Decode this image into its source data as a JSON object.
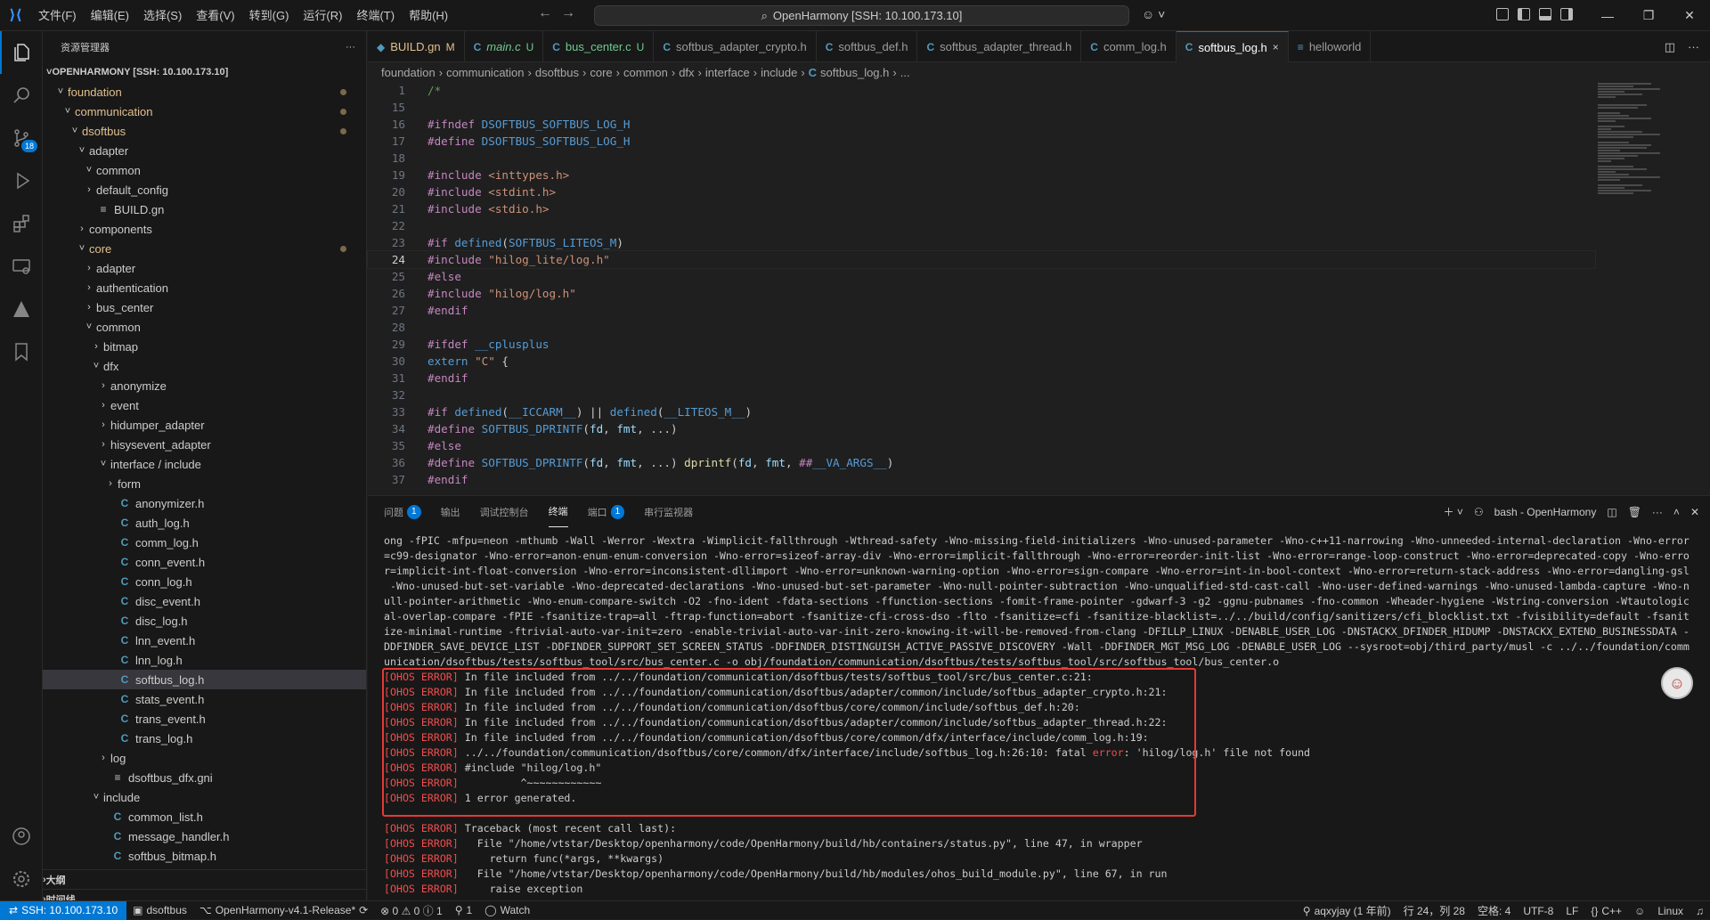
{
  "titlebar": {
    "menu": [
      "文件(F)",
      "编辑(E)",
      "选择(S)",
      "查看(V)",
      "转到(G)",
      "运行(R)",
      "终端(T)",
      "帮助(H)"
    ],
    "search": "OpenHarmony [SSH: 10.100.173.10]"
  },
  "activity": {
    "scm_badge": "18"
  },
  "sidebar": {
    "title": "资源管理器",
    "root": "OPENHARMONY [SSH: 10.100.173.10]",
    "tree": [
      {
        "label": "foundation",
        "depth": 1,
        "type": "folder-open",
        "mod": true
      },
      {
        "label": "communication",
        "depth": 2,
        "type": "folder-open",
        "mod": true
      },
      {
        "label": "dsoftbus",
        "depth": 3,
        "type": "folder-open",
        "mod": true
      },
      {
        "label": "adapter",
        "depth": 4,
        "type": "folder-open"
      },
      {
        "label": "common",
        "depth": 5,
        "type": "folder-open"
      },
      {
        "label": "default_config",
        "depth": 5,
        "type": "folder"
      },
      {
        "label": "BUILD.gn",
        "depth": 5,
        "type": "file"
      },
      {
        "label": "components",
        "depth": 4,
        "type": "folder"
      },
      {
        "label": "core",
        "depth": 4,
        "type": "folder-open",
        "mod": true
      },
      {
        "label": "adapter",
        "depth": 5,
        "type": "folder"
      },
      {
        "label": "authentication",
        "depth": 5,
        "type": "folder"
      },
      {
        "label": "bus_center",
        "depth": 5,
        "type": "folder"
      },
      {
        "label": "common",
        "depth": 5,
        "type": "folder-open"
      },
      {
        "label": "bitmap",
        "depth": 6,
        "type": "folder"
      },
      {
        "label": "dfx",
        "depth": 6,
        "type": "folder-open"
      },
      {
        "label": "anonymize",
        "depth": 7,
        "type": "folder"
      },
      {
        "label": "event",
        "depth": 7,
        "type": "folder"
      },
      {
        "label": "hidumper_adapter",
        "depth": 7,
        "type": "folder"
      },
      {
        "label": "hisysevent_adapter",
        "depth": 7,
        "type": "folder"
      },
      {
        "label": "interface / include",
        "depth": 7,
        "type": "folder-open"
      },
      {
        "label": "form",
        "depth": 8,
        "type": "folder"
      },
      {
        "label": "anonymizer.h",
        "depth": 8,
        "type": "c"
      },
      {
        "label": "auth_log.h",
        "depth": 8,
        "type": "c"
      },
      {
        "label": "comm_log.h",
        "depth": 8,
        "type": "c"
      },
      {
        "label": "conn_event.h",
        "depth": 8,
        "type": "c"
      },
      {
        "label": "conn_log.h",
        "depth": 8,
        "type": "c"
      },
      {
        "label": "disc_event.h",
        "depth": 8,
        "type": "c"
      },
      {
        "label": "disc_log.h",
        "depth": 8,
        "type": "c"
      },
      {
        "label": "lnn_event.h",
        "depth": 8,
        "type": "c"
      },
      {
        "label": "lnn_log.h",
        "depth": 8,
        "type": "c"
      },
      {
        "label": "softbus_log.h",
        "depth": 8,
        "type": "c",
        "selected": true
      },
      {
        "label": "stats_event.h",
        "depth": 8,
        "type": "c"
      },
      {
        "label": "trans_event.h",
        "depth": 8,
        "type": "c"
      },
      {
        "label": "trans_log.h",
        "depth": 8,
        "type": "c"
      },
      {
        "label": "log",
        "depth": 7,
        "type": "folder"
      },
      {
        "label": "dsoftbus_dfx.gni",
        "depth": 7,
        "type": "file"
      },
      {
        "label": "include",
        "depth": 6,
        "type": "folder-open"
      },
      {
        "label": "common_list.h",
        "depth": 7,
        "type": "c"
      },
      {
        "label": "message_handler.h",
        "depth": 7,
        "type": "c"
      },
      {
        "label": "softbus_bitmap.h",
        "depth": 7,
        "type": "c"
      }
    ],
    "outline": "大纲",
    "timeline": "时间线"
  },
  "tabs": [
    {
      "label": "BUILD.gn",
      "status": "M",
      "icon": "gn",
      "cls": "git"
    },
    {
      "label": "main.c",
      "status": "U",
      "icon": "c",
      "cls": "untracked",
      "italic": true
    },
    {
      "label": "bus_center.c",
      "status": "U",
      "icon": "c",
      "cls": "untracked"
    },
    {
      "label": "softbus_adapter_crypto.h",
      "status": "",
      "icon": "c",
      "cls": ""
    },
    {
      "label": "softbus_def.h",
      "status": "",
      "icon": "c",
      "cls": ""
    },
    {
      "label": "softbus_adapter_thread.h",
      "status": "",
      "icon": "c",
      "cls": ""
    },
    {
      "label": "comm_log.h",
      "status": "",
      "icon": "c",
      "cls": ""
    },
    {
      "label": "softbus_log.h",
      "status": "×",
      "icon": "c",
      "cls": "active"
    },
    {
      "label": "helloworld",
      "status": "",
      "icon": "file",
      "cls": ""
    }
  ],
  "breadcrumb": [
    "foundation",
    "communication",
    "dsoftbus",
    "core",
    "common",
    "dfx",
    "interface",
    "include",
    "softbus_log.h",
    "..."
  ],
  "editor": {
    "lines": [
      {
        "n": "1",
        "code": [
          [
            "cmt",
            "/*"
          ]
        ]
      },
      {
        "n": "15",
        "code": []
      },
      {
        "n": "16",
        "code": [
          [
            "kw",
            "#ifndef "
          ],
          [
            "mac",
            "DSOFTBUS_SOFTBUS_LOG_H"
          ]
        ]
      },
      {
        "n": "17",
        "code": [
          [
            "kw",
            "#define "
          ],
          [
            "mac",
            "DSOFTBUS_SOFTBUS_LOG_H"
          ]
        ]
      },
      {
        "n": "18",
        "code": []
      },
      {
        "n": "19",
        "code": [
          [
            "kw",
            "#include "
          ],
          [
            "str",
            "<inttypes.h>"
          ]
        ]
      },
      {
        "n": "20",
        "code": [
          [
            "kw",
            "#include "
          ],
          [
            "str",
            "<stdint.h>"
          ]
        ]
      },
      {
        "n": "21",
        "code": [
          [
            "kw",
            "#include "
          ],
          [
            "str",
            "<stdio.h>"
          ]
        ]
      },
      {
        "n": "22",
        "code": []
      },
      {
        "n": "23",
        "code": [
          [
            "kw",
            "#if "
          ],
          [
            "mac",
            "defined"
          ],
          [
            "pl",
            "("
          ],
          [
            "mac",
            "SOFTBUS_LITEOS_M"
          ],
          [
            "pl",
            ")"
          ]
        ]
      },
      {
        "n": "24",
        "code": [
          [
            "kw",
            "#include "
          ],
          [
            "str",
            "\"hilog_lite/log.h\""
          ]
        ],
        "cur": true
      },
      {
        "n": "25",
        "code": [
          [
            "kw",
            "#else"
          ]
        ]
      },
      {
        "n": "26",
        "code": [
          [
            "kw",
            "#include "
          ],
          [
            "str",
            "\"hilog/log.h\""
          ]
        ]
      },
      {
        "n": "27",
        "code": [
          [
            "kw",
            "#endif"
          ]
        ]
      },
      {
        "n": "28",
        "code": []
      },
      {
        "n": "29",
        "code": [
          [
            "kw",
            "#ifdef "
          ],
          [
            "mac",
            "__cplusplus"
          ]
        ]
      },
      {
        "n": "30",
        "code": [
          [
            "mac",
            "extern "
          ],
          [
            "str",
            "\"C\""
          ],
          [
            "pl",
            " {"
          ]
        ]
      },
      {
        "n": "31",
        "code": [
          [
            "kw",
            "#endif"
          ]
        ]
      },
      {
        "n": "32",
        "code": []
      },
      {
        "n": "33",
        "code": [
          [
            "kw",
            "#if "
          ],
          [
            "mac",
            "defined"
          ],
          [
            "pl",
            "("
          ],
          [
            "mac",
            "__ICCARM__"
          ],
          [
            "pl",
            ") || "
          ],
          [
            "mac",
            "defined"
          ],
          [
            "pl",
            "("
          ],
          [
            "mac",
            "__LITEOS_M__"
          ],
          [
            "pl",
            ")"
          ]
        ]
      },
      {
        "n": "34",
        "code": [
          [
            "kw",
            "#define "
          ],
          [
            "mac",
            "SOFTBUS_DPRINTF"
          ],
          [
            "pl",
            "("
          ],
          [
            "id",
            "fd"
          ],
          [
            "pl",
            ", "
          ],
          [
            "id",
            "fmt"
          ],
          [
            "pl",
            ", ...)"
          ]
        ]
      },
      {
        "n": "35",
        "code": [
          [
            "kw",
            "#else"
          ]
        ]
      },
      {
        "n": "36",
        "code": [
          [
            "kw",
            "#define "
          ],
          [
            "mac",
            "SOFTBUS_DPRINTF"
          ],
          [
            "pl",
            "("
          ],
          [
            "id",
            "fd"
          ],
          [
            "pl",
            ", "
          ],
          [
            "id",
            "fmt"
          ],
          [
            "pl",
            ", ...) "
          ],
          [
            "fn",
            "dprintf"
          ],
          [
            "pl",
            "("
          ],
          [
            "id",
            "fd"
          ],
          [
            "pl",
            ", "
          ],
          [
            "id",
            "fmt"
          ],
          [
            "pl",
            ", "
          ],
          [
            "kw",
            "##"
          ],
          [
            "mac",
            "__VA_ARGS__"
          ],
          [
            "pl",
            ")"
          ]
        ]
      },
      {
        "n": "37",
        "code": [
          [
            "kw",
            "#endif"
          ]
        ]
      }
    ]
  },
  "panel": {
    "tabs": [
      {
        "label": "问题",
        "badge": "1"
      },
      {
        "label": "输出",
        "badge": ""
      },
      {
        "label": "调试控制台",
        "badge": ""
      },
      {
        "label": "终端",
        "badge": "",
        "active": true
      },
      {
        "label": "端口",
        "badge": "1"
      },
      {
        "label": "串行监视器",
        "badge": ""
      }
    ],
    "shell": "bash - OpenHarmony",
    "terminal": [
      {
        "t": "ong -fPIC -mfpu=neon -mthumb -Wall -Werror -Wextra -Wimplicit-fallthrough -Wthread-safety -Wno-missing-field-initializers -Wno-unused-parameter -Wno-c++11-narrowing -Wno-unneeded-internal-declaration -Wno-error"
      },
      {
        "t": "=c99-designator -Wno-error=anon-enum-enum-conversion -Wno-error=sizeof-array-div -Wno-error=implicit-fallthrough -Wno-error=reorder-init-list -Wno-error=range-loop-construct -Wno-error=deprecated-copy -Wno-erro"
      },
      {
        "t": "r=implicit-int-float-conversion -Wno-error=inconsistent-dllimport -Wno-error=unknown-warning-option -Wno-error=sign-compare -Wno-error=int-in-bool-context -Wno-error=return-stack-address -Wno-error=dangling-gsl"
      },
      {
        "t": " -Wno-unused-but-set-variable -Wno-deprecated-declarations -Wno-unused-but-set-parameter -Wno-null-pointer-subtraction -Wno-unqualified-std-cast-call -Wno-user-defined-warnings -Wno-unused-lambda-capture -Wno-n"
      },
      {
        "t": "ull-pointer-arithmetic -Wno-enum-compare-switch -O2 -fno-ident -fdata-sections -ffunction-sections -fomit-frame-pointer -gdwarf-3 -g2 -ggnu-pubnames -fno-common -Wheader-hygiene -Wstring-conversion -Wtautologic"
      },
      {
        "t": "al-overlap-compare -fPIE -fsanitize-trap=all -ftrap-function=abort -fsanitize-cfi-cross-dso -flto -fsanitize=cfi -fsanitize-blacklist=../../build/config/sanitizers/cfi_blocklist.txt -fvisibility=default -fsanit"
      },
      {
        "t": "ize-minimal-runtime -ftrivial-auto-var-init=zero -enable-trivial-auto-var-init-zero-knowing-it-will-be-removed-from-clang -DFILLP_LINUX -DENABLE_USER_LOG -DNSTACKX_DFINDER_HIDUMP -DNSTACKX_EXTEND_BUSINESSDATA -"
      },
      {
        "t": "DDFINDER_SAVE_DEVICE_LIST -DDFINDER_SUPPORT_SET_SCREEN_STATUS -DDFINDER_DISTINGUISH_ACTIVE_PASSIVE_DISCOVERY -Wall -DDFINDER_MGT_MSG_LOG -DENABLE_USER_LOG --sysroot=obj/third_party/musl -c ../../foundation/comm"
      },
      {
        "t": "unication/dsoftbus/tests/softbus_tool/src/bus_center.c -o obj/foundation/communication/dsoftbus/tests/softbus_tool/src/softbus_tool/bus_center.o"
      },
      {
        "e": "[OHOS ERROR]",
        "t": " In file included from ../../foundation/communication/dsoftbus/tests/softbus_tool/src/bus_center.c:21:"
      },
      {
        "e": "[OHOS ERROR]",
        "t": " In file included from ../../foundation/communication/dsoftbus/adapter/common/include/softbus_adapter_crypto.h:21:"
      },
      {
        "e": "[OHOS ERROR]",
        "t": " In file included from ../../foundation/communication/dsoftbus/core/common/include/softbus_def.h:20:"
      },
      {
        "e": "[OHOS ERROR]",
        "t": " In file included from ../../foundation/communication/dsoftbus/adapter/common/include/softbus_adapter_thread.h:22:"
      },
      {
        "e": "[OHOS ERROR]",
        "t": " In file included from ../../foundation/communication/dsoftbus/core/common/dfx/interface/include/comm_log.h:19:"
      },
      {
        "e": "[OHOS ERROR]",
        "t": " ../../foundation/communication/dsoftbus/core/common/dfx/interface/include/softbus_log.h:26:10: fatal error: 'hilog/log.h' file not found"
      },
      {
        "e": "[OHOS ERROR]",
        "t": " #include \"hilog/log.h\""
      },
      {
        "e": "[OHOS ERROR]",
        "t": "          ^~~~~~~~~~~~~"
      },
      {
        "e": "[OHOS ERROR]",
        "t": " 1 error generated."
      },
      {
        "t": ""
      },
      {
        "e": "[OHOS ERROR]",
        "t": " Traceback (most recent call last):"
      },
      {
        "e": "[OHOS ERROR]",
        "t": "   File \"/home/vtstar/Desktop/openharmony/code/OpenHarmony/build/hb/containers/status.py\", line 47, in wrapper"
      },
      {
        "e": "[OHOS ERROR]",
        "t": "     return func(*args, **kwargs)"
      },
      {
        "e": "[OHOS ERROR]",
        "t": "   File \"/home/vtstar/Desktop/openharmony/code/OpenHarmony/build/hb/modules/ohos_build_module.py\", line 67, in run"
      },
      {
        "e": "[OHOS ERROR]",
        "t": "     raise exception"
      }
    ]
  },
  "statusbar": {
    "remote": "SSH: 10.100.173.10",
    "repo": "dsoftbus",
    "branch": "OpenHarmony-v4.1-Release*",
    "problems": "⊗ 0 ⚠ 0 ⓘ 1",
    "ports": "1",
    "watch": "Watch",
    "blame": "aqxyjay (1 年前)",
    "position": "行 24，列 28",
    "spaces": "空格: 4",
    "encoding": "UTF-8",
    "eol": "LF",
    "lang": "C++",
    "platform": "Linux"
  }
}
